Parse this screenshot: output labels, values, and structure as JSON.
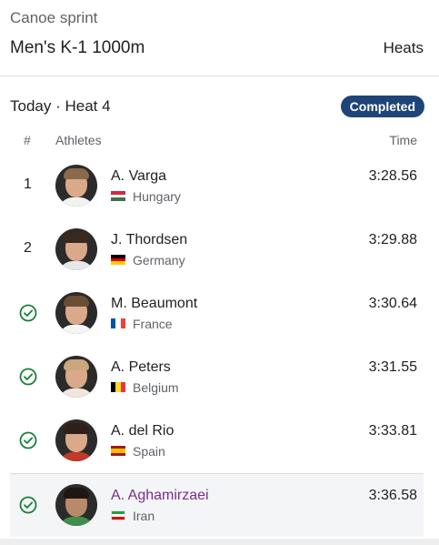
{
  "header": {
    "sport": "Canoe sprint",
    "event": "Men's K-1 1000m",
    "round": "Heats"
  },
  "heat": {
    "title": "Today · Heat 4",
    "status": "Completed"
  },
  "columns": {
    "rank": "#",
    "athletes": "Athletes",
    "time": "Time"
  },
  "athletes": [
    {
      "rank": "1",
      "name": "A. Varga",
      "country": "Hungary",
      "time": "3:28.56",
      "qualified_icon": "none"
    },
    {
      "rank": "2",
      "name": "J. Thordsen",
      "country": "Germany",
      "time": "3:29.88",
      "qualified_icon": "none"
    },
    {
      "rank": "",
      "name": "M. Beaumont",
      "country": "France",
      "time": "3:30.64",
      "qualified_icon": "check-circle-icon"
    },
    {
      "rank": "",
      "name": "A. Peters",
      "country": "Belgium",
      "time": "3:31.55",
      "qualified_icon": "check-circle-icon"
    },
    {
      "rank": "",
      "name": "A. del Rio",
      "country": "Spain",
      "time": "3:33.81",
      "qualified_icon": "check-circle-icon"
    },
    {
      "rank": "",
      "name": "A. Aghamirzaei",
      "country": "Iran",
      "time": "3:36.58",
      "qualified_icon": "check-circle-icon"
    }
  ],
  "colors": {
    "badge": "#1f4477",
    "check": "#188038",
    "highlight_name": "#7b2d8e"
  }
}
